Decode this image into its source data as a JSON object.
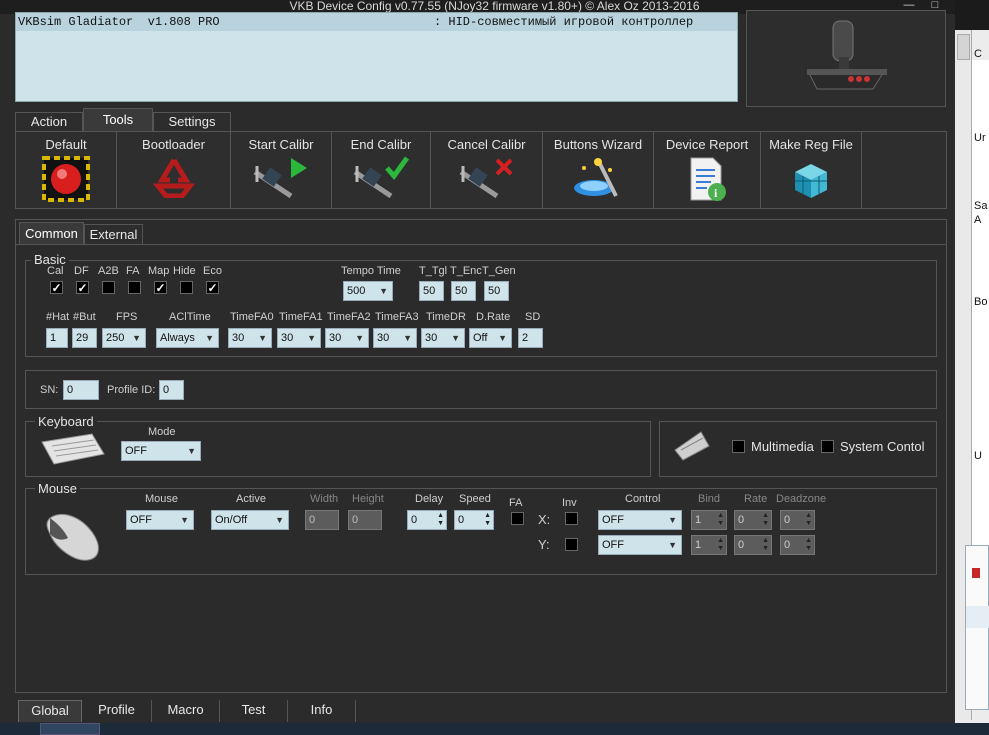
{
  "window": {
    "title": "VKB Device Config v0.77.55 (NJoy32 firmware v1.80+) © Alex Oz 2013-2016"
  },
  "device": {
    "name": "VKBsim Gladiator  v1.808 PRO",
    "desc": ": HID-совместимый игровой контроллер"
  },
  "main_tabs": [
    "Action",
    "Tools",
    "Settings"
  ],
  "tools": [
    {
      "label": "Default",
      "icon": "red-button-icon"
    },
    {
      "label": "Bootloader",
      "icon": "recycle-icon"
    },
    {
      "label": "Start Calibr",
      "icon": "caliper-start-icon"
    },
    {
      "label": "End Calibr",
      "icon": "caliper-end-icon"
    },
    {
      "label": "Cancel Calibr",
      "icon": "caliper-cancel-icon"
    },
    {
      "label": "Buttons Wizard",
      "icon": "wizard-icon"
    },
    {
      "label": "Device Report",
      "icon": "report-icon"
    },
    {
      "label": "Make Reg File",
      "icon": "registry-icon"
    }
  ],
  "sub_tabs": [
    "Common",
    "External"
  ],
  "basic": {
    "label": "Basic",
    "flags": [
      {
        "label": "Cal",
        "checked": true
      },
      {
        "label": "DF",
        "checked": true
      },
      {
        "label": "A2B",
        "checked": false
      },
      {
        "label": "FA",
        "checked": false
      },
      {
        "label": "Map",
        "checked": true
      },
      {
        "label": "Hide",
        "checked": false
      },
      {
        "label": "Eco",
        "checked": true
      }
    ],
    "tempo_label": "Tempo Time",
    "tempo_value": "500",
    "t_tgl_label": "T_Tgl",
    "t_tgl": "50",
    "t_enc_label": "T_Enc",
    "t_enc": "50",
    "t_gen_label": "T_Gen",
    "t_gen": "50",
    "hat_label": "#Hat",
    "hat": "1",
    "but_label": "#But",
    "but": "29",
    "fps_label": "FPS",
    "fps": "250",
    "acltime_label": "AClTime",
    "acltime": "Always",
    "fa0_label": "TimeFA0",
    "fa0": "30",
    "fa1_label": "TimeFA1",
    "fa1": "30",
    "fa2_label": "TimeFA2",
    "fa2": "30",
    "fa3_label": "TimeFA3",
    "fa3": "30",
    "dr_label": "TimeDR",
    "dr": "30",
    "drate_label": "D.Rate",
    "drate": "Off",
    "sd_label": "SD",
    "sd": "2"
  },
  "ids": {
    "sn_label": "SN:",
    "sn": "0",
    "profile_label": "Profile ID:",
    "profile": "0"
  },
  "keyboard": {
    "label": "Keyboard",
    "mode_label": "Mode",
    "mode": "OFF"
  },
  "media": {
    "multimedia": "Multimedia",
    "system": "System Contol"
  },
  "mouse": {
    "label": "Mouse",
    "mouse_label": "Mouse",
    "mouse": "OFF",
    "active_label": "Active",
    "active": "On/Off",
    "width_label": "Width",
    "width": "0",
    "height_label": "Height",
    "height": "0",
    "delay_label": "Delay",
    "delay": "0",
    "speed_label": "Speed",
    "speed": "0",
    "fa_label": "FA",
    "inv_label": "Inv",
    "x_label": "X:",
    "y_label": "Y:",
    "control_label": "Control",
    "control_x": "OFF",
    "control_y": "OFF",
    "bind_label": "Bind",
    "bind_x": "1",
    "bind_y": "1",
    "rate_label": "Rate",
    "rate_x": "0",
    "rate_y": "0",
    "dz_label": "Deadzone",
    "dz_x": "0",
    "dz_y": "0"
  },
  "bottom_tabs": [
    "Global",
    "Profile",
    "Macro",
    "Test",
    "Info"
  ],
  "right_fragments": [
    "C",
    "Ur",
    "Sa",
    "A",
    "Bo",
    "U"
  ]
}
